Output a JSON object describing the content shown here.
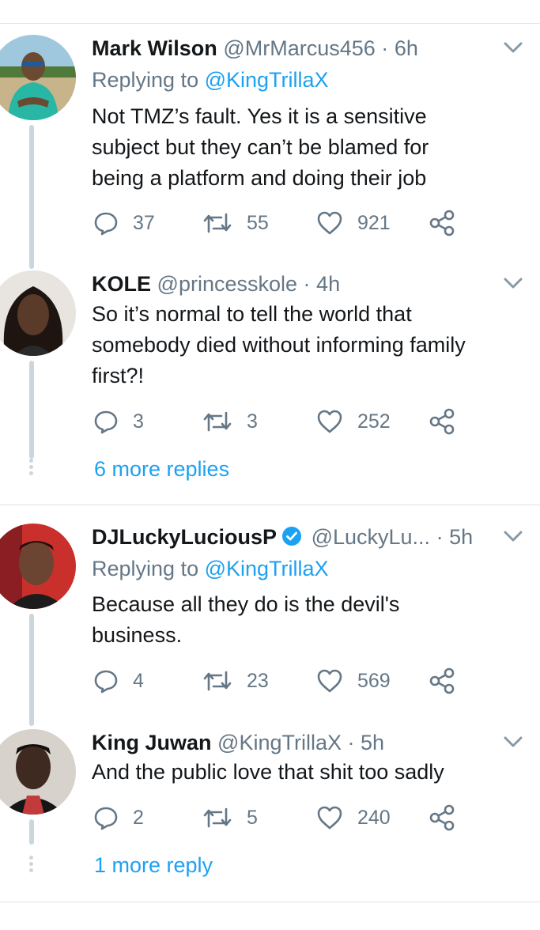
{
  "tweets": [
    {
      "name": "Mark Wilson",
      "handle": "@MrMarcus456",
      "sep": "·",
      "time": "6h",
      "replying_prefix": "Replying to",
      "replying_to": "@KingTrillaX",
      "lines": [
        "Not TMZ’s fault. Yes it is a sensitive",
        "subject but they can’t be blamed for",
        "being a platform and doing their job"
      ],
      "replies": "37",
      "retweets": "55",
      "likes": "921"
    },
    {
      "name": "KOLE",
      "handle": "@princesskole",
      "sep": "·",
      "time": "4h",
      "lines": [
        "So it’s normal to tell the world that",
        "somebody died without informing family",
        "first?!"
      ],
      "replies": "3",
      "retweets": "3",
      "likes": "252",
      "more": "6 more replies"
    },
    {
      "name": "DJLuckyLuciousP",
      "handle": "@LuckyLu...",
      "sep": "·",
      "time": "5h",
      "replying_prefix": "Replying to",
      "replying_to": "@KingTrillaX",
      "lines": [
        "Because all they do is the devil's",
        "business."
      ],
      "replies": "4",
      "retweets": "23",
      "likes": "569"
    },
    {
      "name": "King Juwan",
      "handle": "@KingTrillaX",
      "sep": "·",
      "time": "5h",
      "lines": [
        "And the public love that shit too sadly"
      ],
      "replies": "2",
      "retweets": "5",
      "likes": "240",
      "more": "1 more reply"
    }
  ],
  "colors": {
    "link": "#1da1f2",
    "secondary": "#657786",
    "text": "#14171a",
    "thread": "#ccd6dd",
    "divider": "#dfe3e6"
  },
  "icons": [
    "reply-icon",
    "retweet-icon",
    "like-icon",
    "share-icon",
    "chevron-down-icon",
    "verified-icon"
  ]
}
